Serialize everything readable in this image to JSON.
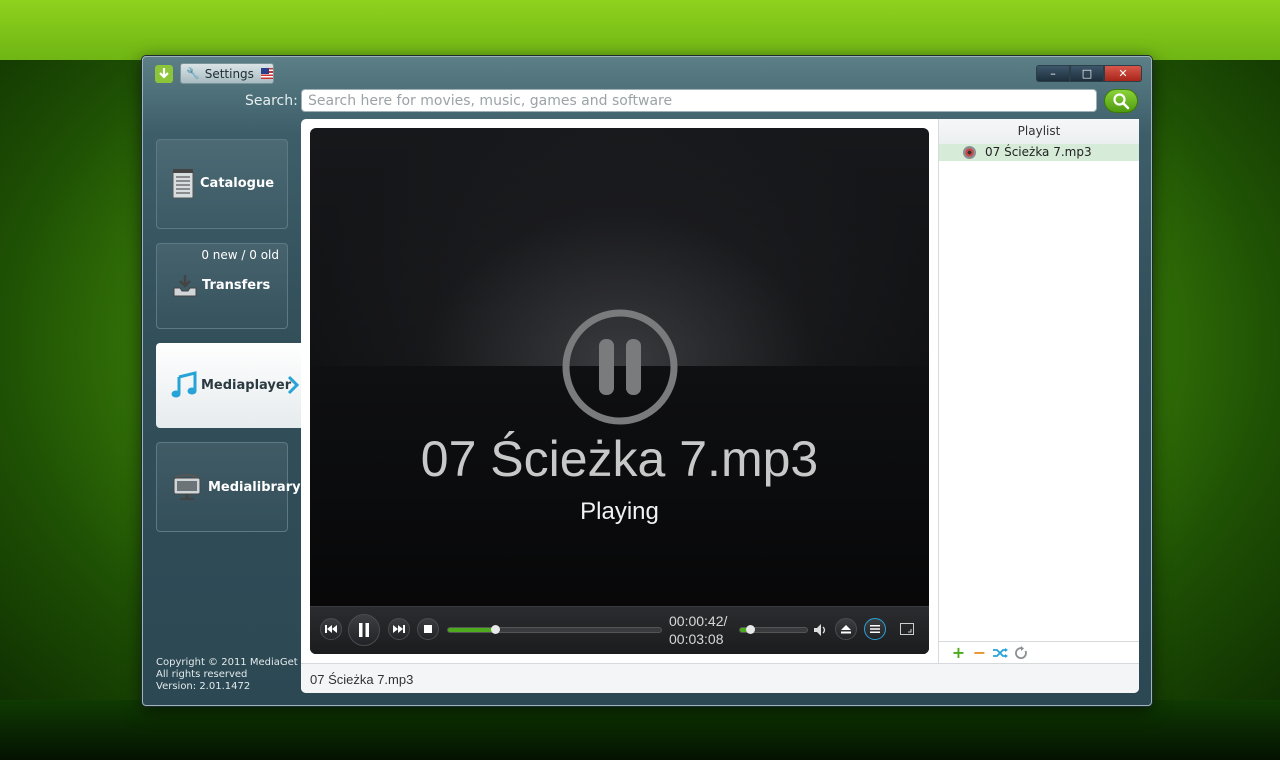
{
  "window": {
    "settings_label": "Settings",
    "controls": {
      "minimize": "–",
      "maximize": "□",
      "close": "✕"
    }
  },
  "search": {
    "label": "Search:",
    "placeholder": "Search here for movies, music, games and software"
  },
  "sidebar": {
    "items": [
      {
        "label": "Catalogue"
      },
      {
        "label": "Transfers",
        "badge": "0 new / 0 old"
      },
      {
        "label": "Mediaplayer"
      },
      {
        "label": "Medialibrary"
      }
    ],
    "footer": {
      "copyright": "Copyright © 2011 MediaGet",
      "rights": "All rights reserved",
      "version": "Version: 2.01.1472"
    }
  },
  "player": {
    "title": "07 Ścieżka 7.mp3",
    "status": "Playing",
    "elapsed": "00:00:42/",
    "duration": "00:03:08",
    "progress": 0.22,
    "volume": 0.15
  },
  "playlist": {
    "header": "Playlist",
    "items": [
      {
        "label": "07 Ścieżka 7.mp3"
      }
    ]
  },
  "status_bar": {
    "text": "07 Ścieżka 7.mp3"
  },
  "colors": {
    "accent_green": "#4caa1c",
    "highlight_row": "#d6ecd8",
    "nav_icon_blue": "#27a3d8"
  }
}
